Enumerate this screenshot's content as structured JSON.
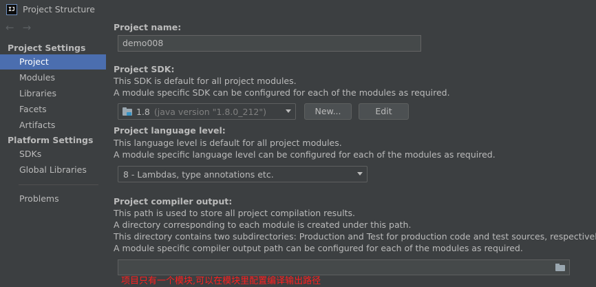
{
  "window": {
    "title": "Project Structure",
    "app_icon_text": "IJ"
  },
  "sidebar": {
    "nav": {
      "back_icon": "arrow-left",
      "forward_icon": "arrow-right"
    },
    "project_settings_title": "Project Settings",
    "project_settings_items": [
      "Project",
      "Modules",
      "Libraries",
      "Facets",
      "Artifacts"
    ],
    "platform_settings_title": "Platform Settings",
    "platform_settings_items": [
      "SDKs",
      "Global Libraries"
    ],
    "problems_label": "Problems",
    "selected": "Project"
  },
  "main": {
    "project_name": {
      "heading": "Project name:",
      "value": "demo008"
    },
    "sdk": {
      "heading": "Project SDK:",
      "desc1": "This SDK is default for all project modules.",
      "desc2": "A module specific SDK can be configured for each of the modules as required.",
      "selected_version": "1.8",
      "selected_hint": "(java version \"1.8.0_212\")",
      "new_button": "New...",
      "edit_button": "Edit"
    },
    "language_level": {
      "heading": "Project language level:",
      "desc1": "This language level is default for all project modules.",
      "desc2": "A module specific language level can be configured for each of the modules as required.",
      "selected": "8 - Lambdas, type annotations etc."
    },
    "compiler_output": {
      "heading": "Project compiler output:",
      "desc1": "This path is used to store all project compilation results.",
      "desc2": "A directory corresponding to each module is created under this path.",
      "desc3": "This directory contains two subdirectories: Production and Test for production code and test sources, respectively.",
      "desc4": "A module specific compiler output path can be configured for each of the modules as required.",
      "path_value": ""
    }
  },
  "annotation": "项目只有一个模块,可以在模块里配置编译输出路径",
  "colors": {
    "background": "#3c3f41",
    "selection": "#4b6eaf",
    "text": "#bbbbbb",
    "annotation": "#ff2020"
  }
}
